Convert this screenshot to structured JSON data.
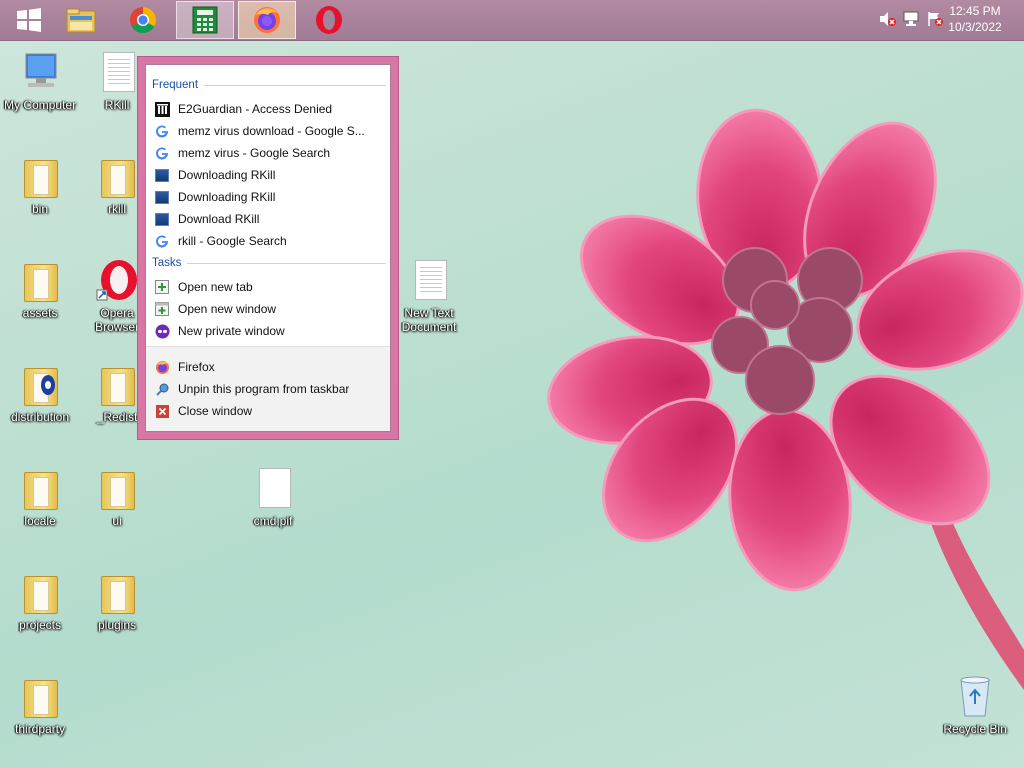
{
  "taskbar": {
    "pinned": [
      {
        "name": "start-button",
        "label": "Start"
      },
      {
        "name": "file-explorer-taskbar-button",
        "label": "File Explorer"
      },
      {
        "name": "chrome-taskbar-button",
        "label": "Google Chrome"
      },
      {
        "name": "calculator-taskbar-button",
        "label": "Calculator"
      },
      {
        "name": "firefox-taskbar-button",
        "label": "Firefox"
      },
      {
        "name": "opera-taskbar-button",
        "label": "Opera"
      }
    ],
    "clock": {
      "time": "12:45 PM",
      "date": "10/3/2022"
    }
  },
  "desktop": {
    "icons": [
      {
        "id": "my-computer",
        "label": "My Computer"
      },
      {
        "id": "rkill",
        "label": "RKill"
      },
      {
        "id": "bin",
        "label": "bin"
      },
      {
        "id": "rkill-folder",
        "label": "rkill"
      },
      {
        "id": "assets",
        "label": "assets"
      },
      {
        "id": "opera-browser",
        "label": "Opera Browser"
      },
      {
        "id": "new-text-document",
        "label": "New Text Document"
      },
      {
        "id": "distribution",
        "label": "distribution"
      },
      {
        "id": "redist",
        "label": "_Redist"
      },
      {
        "id": "locale",
        "label": "locale"
      },
      {
        "id": "ui",
        "label": "ui"
      },
      {
        "id": "cmd-pif",
        "label": "cmd.pif"
      },
      {
        "id": "projects",
        "label": "projects"
      },
      {
        "id": "plugins",
        "label": "plugins"
      },
      {
        "id": "thirdparty",
        "label": "thirdparty"
      },
      {
        "id": "recycle-bin",
        "label": "Recycle Bin"
      }
    ]
  },
  "jumplist": {
    "frequent_header": "Frequent",
    "frequent": [
      {
        "label": "E2Guardian - Access Denied",
        "icon": "e2guardian-icon"
      },
      {
        "label": "memz virus download - Google S...",
        "icon": "google-icon"
      },
      {
        "label": "memz virus - Google Search",
        "icon": "google-icon"
      },
      {
        "label": "Downloading RKill",
        "icon": "download-page-icon"
      },
      {
        "label": "Downloading RKill",
        "icon": "download-page-icon"
      },
      {
        "label": "Download RKill",
        "icon": "download-page-icon"
      },
      {
        "label": "rkill - Google Search",
        "icon": "google-icon"
      }
    ],
    "tasks_header": "Tasks",
    "tasks": [
      {
        "label": "Open new tab",
        "icon": "new-tab-icon"
      },
      {
        "label": "Open new window",
        "icon": "new-window-icon"
      },
      {
        "label": "New private window",
        "icon": "private-window-icon"
      }
    ],
    "bottom": [
      {
        "label": "Firefox",
        "icon": "firefox-icon"
      },
      {
        "label": "Unpin this program from taskbar",
        "icon": "unpin-icon"
      },
      {
        "label": "Close window",
        "icon": "close-icon"
      }
    ]
  }
}
